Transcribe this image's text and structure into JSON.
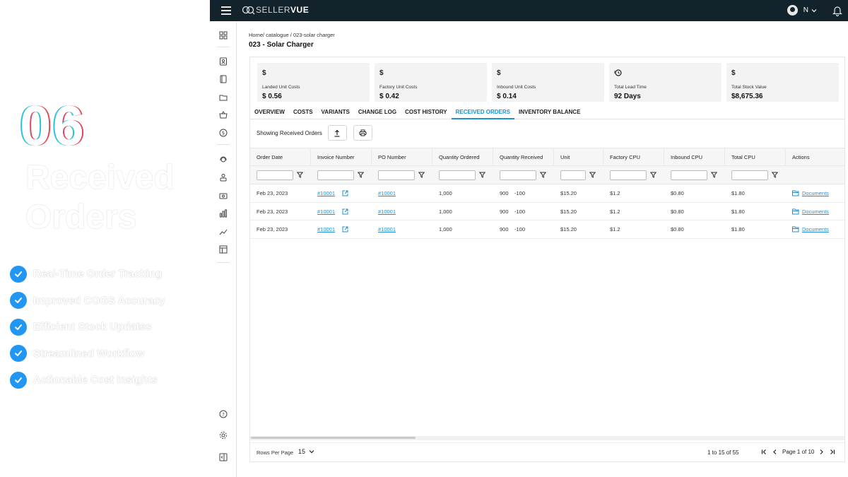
{
  "promo": {
    "number": "06",
    "title": "Received Orders",
    "features": [
      "Real-Time Order Tracking",
      "Improved COGS Accuracy",
      "Efficient Stock Updates",
      "Streamlined Workflow",
      "Actionable Cost Insights"
    ]
  },
  "app": {
    "logo_light": "SELLER",
    "logo_bold": "VUE",
    "user_initial": "N"
  },
  "breadcrumb": "Home/ catalogue  / 023-solar charger",
  "page_title": "023 - Solar Charger",
  "cards": [
    {
      "symbol": "$",
      "label": "Landed Unit Costs",
      "value": "$ 0.56"
    },
    {
      "symbol": "$",
      "label": "Factory Unit Costs",
      "value": "$ 0.42"
    },
    {
      "symbol": "$",
      "label": "Inbound Unit Costs",
      "value": "$ 0.14"
    },
    {
      "symbol": "clock",
      "label": "Total Lead Time",
      "value": "92 Days"
    },
    {
      "symbol": "$",
      "label": "Total Stock Value",
      "value": "$8,675.36"
    }
  ],
  "tabs": [
    "OVERVIEW",
    "COSTS",
    "VARIANTS",
    "CHANGE LOG",
    "COST HISTORY",
    "RECEIVED ORDERS",
    "INVENTORY BALANCE"
  ],
  "active_tab": "RECEIVED ORDERS",
  "toolbar_text": "Showing Received Orders",
  "columns": [
    "Order Date",
    "Invoice Number",
    "PO Number",
    "Quantity Ordered",
    "Quantity Received",
    "Unit",
    "Factory CPU",
    "Inbound CPU",
    "Total CPU",
    "Actions"
  ],
  "rows": [
    {
      "order_date": "Feb 23, 2023",
      "invoice": "#10001",
      "po": "#10001",
      "qty_ordered": "1,000",
      "qty_received": "900",
      "qty_diff": "-100",
      "unit": "$15.20",
      "factory_cpu": "$1.2",
      "inbound_cpu": "$0.80",
      "total_cpu": "$1.80",
      "action": "Documents"
    },
    {
      "order_date": "Feb 23, 2023",
      "invoice": "#10001",
      "po": "#10001",
      "qty_ordered": "1,000",
      "qty_received": "900",
      "qty_diff": "-100",
      "unit": "$15.20",
      "factory_cpu": "$1.2",
      "inbound_cpu": "$0.80",
      "total_cpu": "$1.80",
      "action": "Documents"
    },
    {
      "order_date": "Feb 23, 2023",
      "invoice": "#10001",
      "po": "#10001",
      "qty_ordered": "1,000",
      "qty_received": "900",
      "qty_diff": "-100",
      "unit": "$15.20",
      "factory_cpu": "$1.2",
      "inbound_cpu": "$0.80",
      "total_cpu": "$1.80",
      "action": "Documents"
    }
  ],
  "footer": {
    "rows_per_page_label": "Rows Per Page",
    "rows_per_page_value": "15",
    "range": "1 to 15 of 55",
    "page_label": "Page 1 of 10"
  },
  "colors": {
    "accent": "#1e8fd0",
    "topbar": "#13232b",
    "check": "#2196f3"
  }
}
